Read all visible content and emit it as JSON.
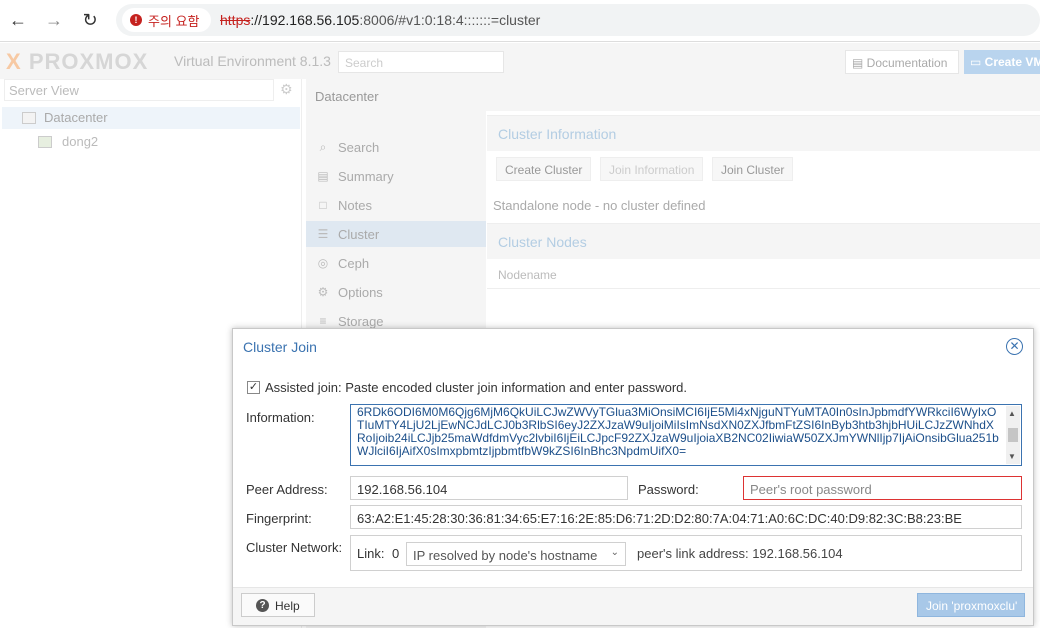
{
  "browser": {
    "back_icon": "←",
    "forward_icon": "→",
    "reload_icon": "↻",
    "warning_label": "주의 요함",
    "url_scheme": "https",
    "url_host": "://192.168.56.105",
    "url_rest": ":8006/#v1:0:18:4:::::::=cluster"
  },
  "app": {
    "logo": "PROXMOX",
    "version": "Virtual Environment 8.1.3",
    "search_placeholder": "Search",
    "documentation_label": "Documentation",
    "create_vm_label": "Create VM"
  },
  "sidebar": {
    "view": "Server View",
    "tree": [
      {
        "label": "Datacenter"
      },
      {
        "label": "dong2"
      }
    ]
  },
  "breadcrumb": "Datacenter",
  "menu": [
    {
      "label": "Search",
      "icon": "search-icon"
    },
    {
      "label": "Summary",
      "icon": "book-icon"
    },
    {
      "label": "Notes",
      "icon": "notes-icon"
    },
    {
      "label": "Cluster",
      "icon": "server-icon"
    },
    {
      "label": "Ceph",
      "icon": "ceph-icon"
    },
    {
      "label": "Options",
      "icon": "gear-icon"
    },
    {
      "label": "Storage",
      "icon": "database-icon"
    }
  ],
  "content": {
    "cluster_info_title": "Cluster Information",
    "create_cluster": "Create Cluster",
    "join_information": "Join Information",
    "join_cluster": "Join Cluster",
    "standalone": "Standalone node - no cluster defined",
    "cluster_nodes_title": "Cluster Nodes",
    "nodename_header": "Nodename"
  },
  "dialog": {
    "title": "Cluster Join",
    "assisted_label": "Assisted join: Paste encoded cluster join information and enter password.",
    "information_label": "Information:",
    "information_value": "6RDk6ODI6M0M6Qjg6MjM6QkUiLCJwZWVyTGlua3MiOnsiMCI6IjE5Mi4xNjguNTYuMTA0In0sInJpbmdfYWRkciI6WyIxOTIuMTY4LjU2LjEwNCJdLCJ0b3RlbSI6eyJ2ZXJzaW9uIjoiMiIsImNsdXN0ZXJfbmFtZSI6InByb3htb3hjbHUiLCJzZWNhdXRoIjoib24iLCJjb25maWdfdmVyc2lvbiI6IjEiLCJpcF92ZXJzaW9uIjoiaXB2NC02IiwiaW50ZXJmYWNlIjp7IjAiOnsibGlua251bWJlciI6IjAifX0sImxpbmtzIjpbmtfbW9kZSI6InBhc3NpdmUifX0=",
    "peer_address_label": "Peer Address:",
    "peer_address_value": "192.168.56.104",
    "password_label": "Password:",
    "password_placeholder": "Peer's root password",
    "fingerprint_label": "Fingerprint:",
    "fingerprint_value": "63:A2:E1:45:28:30:36:81:34:65:E7:16:2E:85:D6:71:2D:D2:80:7A:04:71:A0:6C:DC:40:D9:82:3C:B8:23:BE",
    "network_label": "Cluster Network:",
    "link_label": "Link:",
    "link_number": "0",
    "link_select": "IP resolved by node's hostname",
    "peer_link": "peer's link address: 192.168.56.104",
    "help_label": "Help",
    "join_label": "Join 'proxmoxclu'"
  }
}
